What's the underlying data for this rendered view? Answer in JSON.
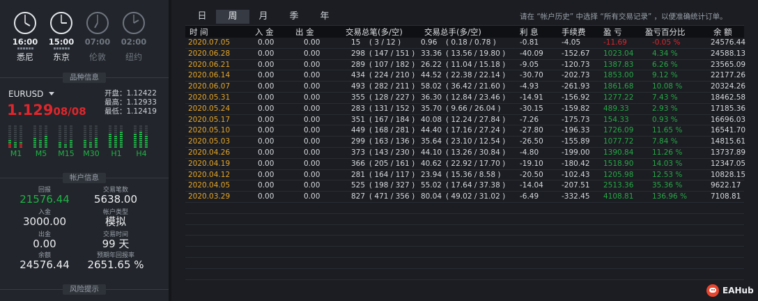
{
  "clocks": [
    {
      "time": "16:00",
      "city": "悉尼",
      "active": true
    },
    {
      "time": "15:00",
      "city": "东京",
      "active": true
    },
    {
      "time": "07:00",
      "city": "伦敦",
      "active": false
    },
    {
      "time": "02:00",
      "city": "纽约",
      "active": false
    }
  ],
  "sections": {
    "symbol_info": "品种信息",
    "account_info": "帐户信息",
    "risk_hint": "风险提示"
  },
  "symbol": {
    "name": "EURUSD",
    "price_big": "1.129",
    "price_small": "08/08",
    "open": "开盘：1.12422",
    "high": "最高：1.12933",
    "low": "最低：1.12419"
  },
  "timeframes": [
    {
      "label": "M1",
      "cols": [
        {
          "g": 2,
          "r": 2
        },
        {
          "g": 3,
          "r": 0
        },
        {
          "g": 1,
          "r": 2
        }
      ]
    },
    {
      "label": "M5",
      "cols": [
        {
          "g": 5,
          "r": 0
        },
        {
          "g": 4,
          "r": 0
        },
        {
          "g": 6,
          "r": 0
        }
      ]
    },
    {
      "label": "M15",
      "cols": [
        {
          "g": 3,
          "r": 0
        },
        {
          "g": 2,
          "r": 0
        },
        {
          "g": 4,
          "r": 0
        }
      ]
    },
    {
      "label": "M30",
      "cols": [
        {
          "g": 4,
          "r": 0
        },
        {
          "g": 3,
          "r": 0
        },
        {
          "g": 5,
          "r": 0
        }
      ]
    },
    {
      "label": "H1",
      "cols": [
        {
          "g": 7,
          "r": 0
        },
        {
          "g": 6,
          "r": 0
        },
        {
          "g": 8,
          "r": 0
        }
      ]
    },
    {
      "label": "H4",
      "cols": [
        {
          "g": 7,
          "r": 0
        },
        {
          "g": 8,
          "r": 0
        },
        {
          "g": 6,
          "r": 0
        }
      ]
    }
  ],
  "account": {
    "profit_label": "回报",
    "profit": "21576.44",
    "trades_label": "交易笔数",
    "trades": "5638.00",
    "deposit_label": "入金",
    "deposit": "3000.00",
    "type_label": "帐户类型",
    "type": "模拟",
    "withdraw_label": "出金",
    "withdraw": "0.00",
    "days_label": "交易时间",
    "days": "99 天",
    "balance_label": "余额",
    "balance": "24576.44",
    "annual_label": "预期年回报率",
    "annual": "2651.65 %"
  },
  "tabs": [
    "日",
    "周",
    "月",
    "季",
    "年"
  ],
  "active_tab": "周",
  "hint": "请在 “帐户历史” 中选择 “所有交易记录” ，以便准确统计订单。",
  "table": {
    "columns": [
      "时 间",
      "入 金",
      "出 金",
      "交易总笔(多/空)",
      "交易总手(多/空)",
      "利 息",
      "手续费",
      "盈 亏",
      "盈亏百分比",
      "余 额"
    ],
    "rows": [
      [
        "2020.07.05",
        "0.00",
        "0.00",
        "15",
        "( 3 / 12 )",
        "0.96",
        "( 0.18 / 0.78 )",
        "-0.81",
        "-4.05",
        "-11.69",
        "-0.05 %",
        "24576.44"
      ],
      [
        "2020.06.28",
        "0.00",
        "0.00",
        "298",
        "( 147 / 151 )",
        "33.36",
        "( 13.56 / 19.80 )",
        "-40.09",
        "-152.67",
        "1023.04",
        "4.34 %",
        "24588.13"
      ],
      [
        "2020.06.21",
        "0.00",
        "0.00",
        "289",
        "( 107 / 182 )",
        "26.22",
        "( 11.04 / 15.18 )",
        "-9.05",
        "-120.73",
        "1387.83",
        "6.26 %",
        "23565.09"
      ],
      [
        "2020.06.14",
        "0.00",
        "0.00",
        "434",
        "( 224 / 210 )",
        "44.52",
        "( 22.38 / 22.14 )",
        "-30.70",
        "-202.73",
        "1853.00",
        "9.12 %",
        "22177.26"
      ],
      [
        "2020.06.07",
        "0.00",
        "0.00",
        "493",
        "( 282 / 211 )",
        "58.02",
        "( 36.42 / 21.60 )",
        "-4.93",
        "-261.93",
        "1861.68",
        "10.08 %",
        "20324.26"
      ],
      [
        "2020.05.31",
        "0.00",
        "0.00",
        "355",
        "( 128 / 227 )",
        "36.30",
        "( 12.84 / 23.46 )",
        "-14.91",
        "-156.92",
        "1277.22",
        "7.43 %",
        "18462.58"
      ],
      [
        "2020.05.24",
        "0.00",
        "0.00",
        "283",
        "( 131 / 152 )",
        "35.70",
        "( 9.66 / 26.04 )",
        "-30.15",
        "-159.82",
        "489.33",
        "2.93 %",
        "17185.36"
      ],
      [
        "2020.05.17",
        "0.00",
        "0.00",
        "351",
        "( 167 / 184 )",
        "40.08",
        "( 12.24 / 27.84 )",
        "-7.26",
        "-175.73",
        "154.33",
        "0.93 %",
        "16696.03"
      ],
      [
        "2020.05.10",
        "0.00",
        "0.00",
        "449",
        "( 168 / 281 )",
        "44.40",
        "( 17.16 / 27.24 )",
        "-27.80",
        "-196.33",
        "1726.09",
        "11.65 %",
        "16541.70"
      ],
      [
        "2020.05.03",
        "0.00",
        "0.00",
        "299",
        "( 163 / 136 )",
        "35.64",
        "( 23.10 / 12.54 )",
        "-26.50",
        "-155.89",
        "1077.72",
        "7.84 %",
        "14815.61"
      ],
      [
        "2020.04.26",
        "0.00",
        "0.00",
        "373",
        "( 143 / 230 )",
        "44.10",
        "( 13.26 / 30.84 )",
        "-4.80",
        "-199.00",
        "1390.84",
        "11.26 %",
        "13737.89"
      ],
      [
        "2020.04.19",
        "0.00",
        "0.00",
        "366",
        "( 205 / 161 )",
        "40.62",
        "( 22.92 / 17.70 )",
        "-19.10",
        "-180.42",
        "1518.90",
        "14.03 %",
        "12347.05"
      ],
      [
        "2020.04.12",
        "0.00",
        "0.00",
        "281",
        "( 164 / 117 )",
        "23.94",
        "( 15.36 / 8.58 )",
        "-20.50",
        "-102.43",
        "1205.98",
        "12.53 %",
        "10828.15"
      ],
      [
        "2020.04.05",
        "0.00",
        "0.00",
        "525",
        "( 198 / 327 )",
        "55.02",
        "( 17.64 / 37.38 )",
        "-14.04",
        "-207.51",
        "2513.36",
        "35.36 %",
        "9622.17"
      ],
      [
        "2020.03.29",
        "0.00",
        "0.00",
        "827",
        "( 471 / 356 )",
        "80.04",
        "( 49.02 / 31.02 )",
        "-6.49",
        "-332.45",
        "4108.81",
        "136.96 %",
        "7108.81"
      ]
    ],
    "empty_rows": 7
  },
  "watermark": "EAHub",
  "colors": {
    "date": "#e7a626",
    "gain": "#26a845",
    "loss": "#e0262c",
    "price": "#e0262c"
  }
}
